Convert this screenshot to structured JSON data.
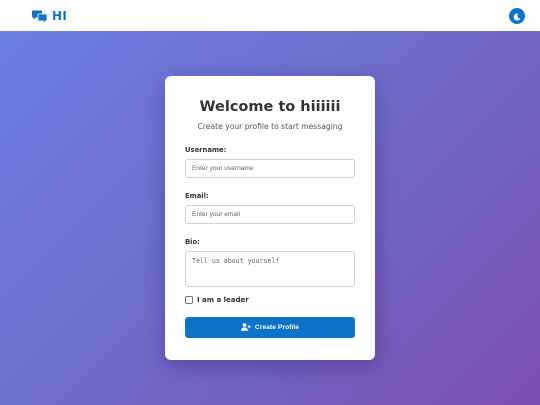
{
  "header": {
    "brand_icon": "comments-icon",
    "brand_text": "HI",
    "theme_toggle_icon": "moon-icon"
  },
  "card": {
    "title": "Welcome to hiiiiii",
    "subtitle": "Create your profile to start messaging",
    "username": {
      "label": "Username:",
      "placeholder": "Enter your username",
      "value": ""
    },
    "email": {
      "label": "Email:",
      "placeholder": "Enter your email",
      "value": ""
    },
    "bio": {
      "label": "Bio:",
      "placeholder": "Tell us about yourself",
      "value": ""
    },
    "leader_checkbox": {
      "label": "I am a leader",
      "checked": false
    },
    "submit": {
      "label": "Create Profile",
      "icon": "user-plus-icon"
    }
  },
  "colors": {
    "accent": "#0b73c8",
    "gradient_start": "#6c7fe4",
    "gradient_end": "#7a4fb0"
  }
}
